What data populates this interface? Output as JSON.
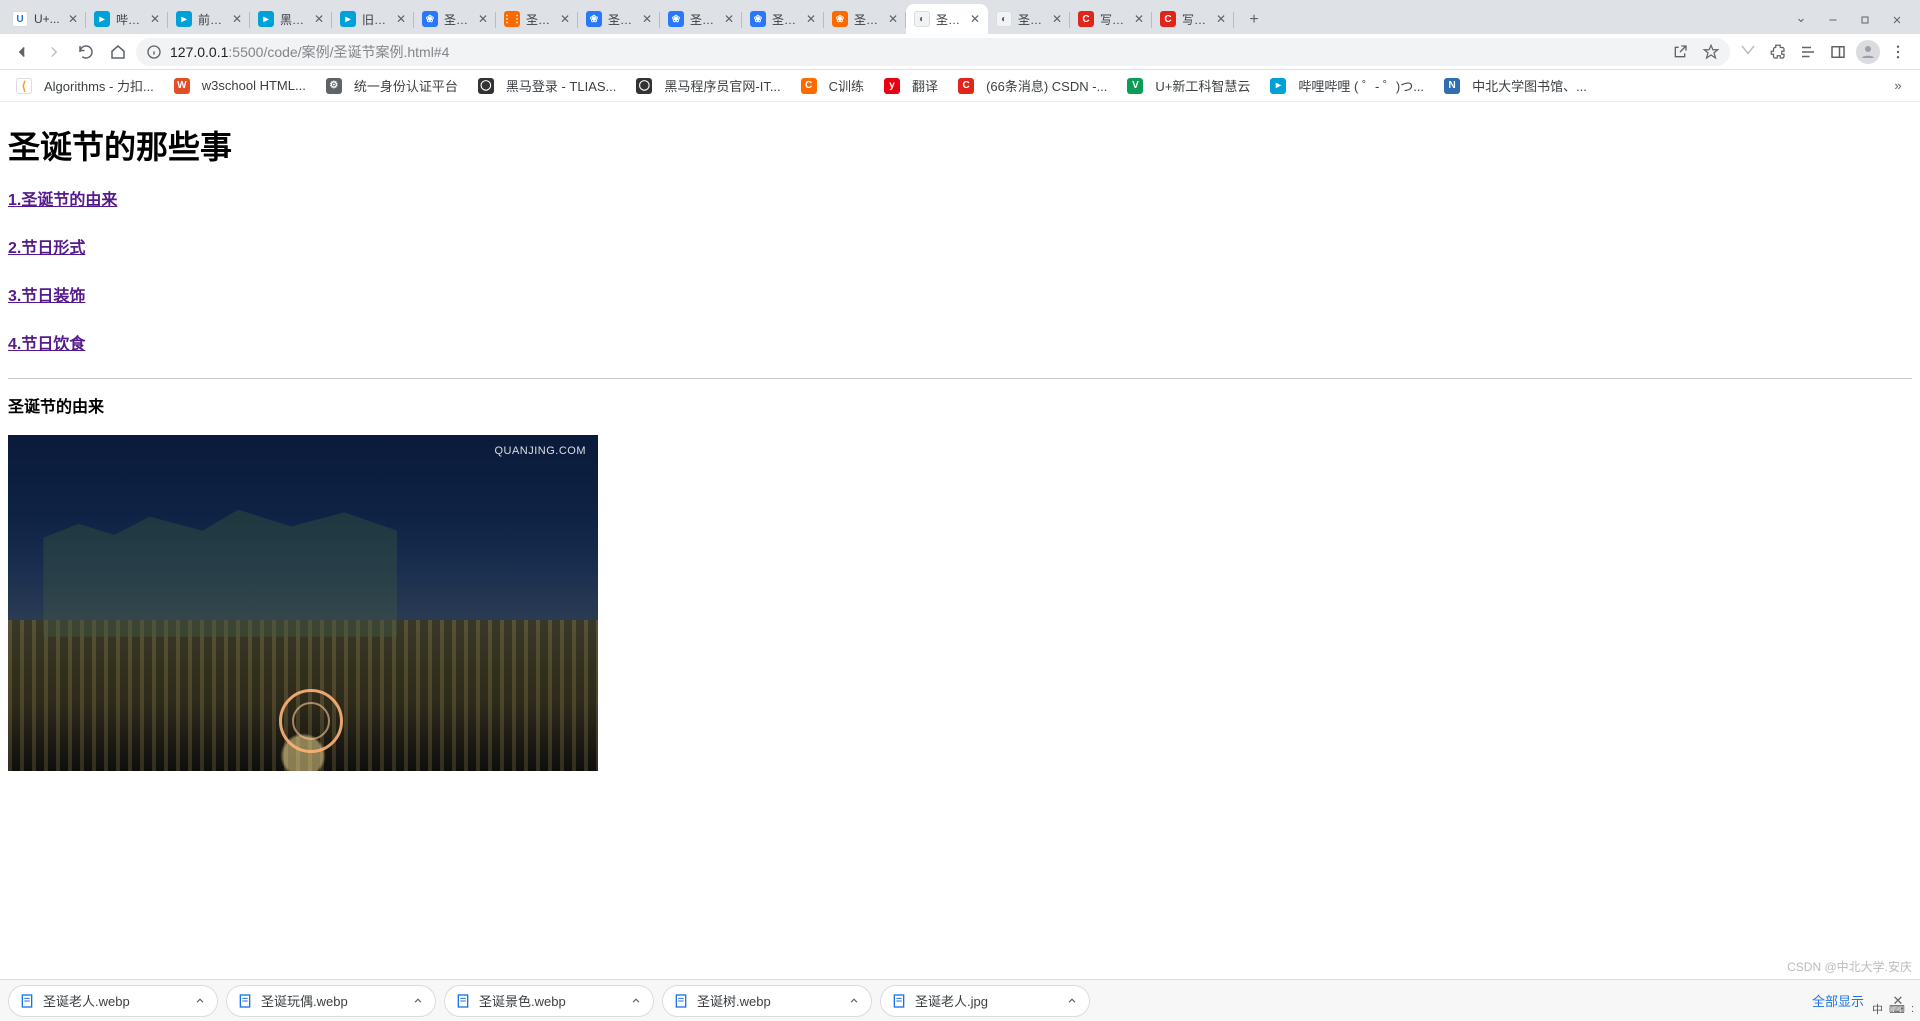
{
  "tabs": [
    {
      "title": "U+...",
      "favClass": "fv-u",
      "favText": "U"
    },
    {
      "title": "哔哩...",
      "favClass": "fv-bili",
      "favText": "▸"
    },
    {
      "title": "前端...",
      "favClass": "fv-bili",
      "favText": "▸"
    },
    {
      "title": "黑马...",
      "favClass": "fv-bili",
      "favText": "▸"
    },
    {
      "title": "旧版...",
      "favClass": "fv-bili",
      "favText": "▸"
    },
    {
      "title": "圣诞...",
      "favClass": "fv-paw",
      "favText": "❀"
    },
    {
      "title": "圣诞...",
      "favClass": "fv-grid",
      "favText": "⋮⋮"
    },
    {
      "title": "圣诞...",
      "favClass": "fv-paw",
      "favText": "❀"
    },
    {
      "title": "圣诞...",
      "favClass": "fv-paw",
      "favText": "❀"
    },
    {
      "title": "圣诞...",
      "favClass": "fv-paw",
      "favText": "❀"
    },
    {
      "title": "圣诞...",
      "favClass": "fv-orange",
      "favText": "❀"
    },
    {
      "title": "圣诞...",
      "favClass": "fv-globe",
      "favText": "◐",
      "active": true
    },
    {
      "title": "圣诞...",
      "favClass": "fv-globe",
      "favText": "◐"
    },
    {
      "title": "写文...",
      "favClass": "fv-c",
      "favText": "C"
    },
    {
      "title": "写文...",
      "favClass": "fv-c",
      "favText": "C"
    }
  ],
  "url": {
    "host": "127.0.0.1",
    "port": ":5500",
    "path": "/code/案例/圣诞节案例.html#4"
  },
  "bookmarks": [
    {
      "label": "Algorithms - 力扣...",
      "iconClass": "fv-lc",
      "iconText": "⟨"
    },
    {
      "label": "w3school HTML...",
      "iconClass": "fv-w3",
      "iconText": "W"
    },
    {
      "label": "统一身份认证平台",
      "iconClass": "fv-gear",
      "iconText": "⚙"
    },
    {
      "label": "黑马登录 - TLIAS...",
      "iconClass": "fv-hm",
      "iconText": "◯"
    },
    {
      "label": "黑马程序员官网-IT...",
      "iconClass": "fv-hm",
      "iconText": "◯"
    },
    {
      "label": "C训练",
      "iconClass": "fv-orange",
      "iconText": "C"
    },
    {
      "label": "翻译",
      "iconClass": "fv-youdao",
      "iconText": "y"
    },
    {
      "label": "(66条消息) CSDN -...",
      "iconClass": "fv-c",
      "iconText": "C"
    },
    {
      "label": "U+新工科智慧云",
      "iconClass": "fv-v",
      "iconText": "V"
    },
    {
      "label": "哔哩哔哩 (  ゜- ゜)つ...",
      "iconClass": "fv-bili",
      "iconText": "▸"
    },
    {
      "label": "中北大学图书馆、...",
      "iconClass": "fv-nuc",
      "iconText": "N"
    }
  ],
  "page": {
    "h1": "圣诞节的那些事",
    "toc": [
      "1.圣诞节的由来",
      "2.节日形式",
      "3.节日装饰",
      "4.节日饮食"
    ],
    "section1": "圣诞节的由来",
    "imgWatermark": "QUANJING.COM"
  },
  "downloads": {
    "items": [
      "圣诞老人.webp",
      "圣诞玩偶.webp",
      "圣诞景色.webp",
      "圣诞树.webp",
      "圣诞老人.jpg"
    ],
    "showAll": "全部显示"
  },
  "csdnWatermark": "CSDN @中北大学.安庆",
  "ime": {
    "mode": "中",
    "kb": "⌨",
    "sep": ":"
  }
}
